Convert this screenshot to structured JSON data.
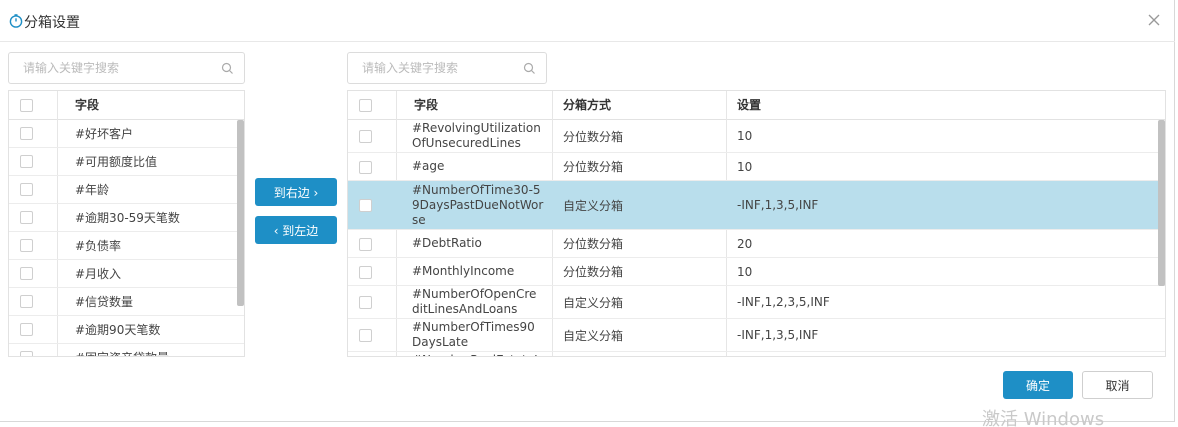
{
  "dialog": {
    "title": "分箱设置",
    "close_symbol": "✕"
  },
  "left": {
    "search_placeholder": "请输入关键字搜索",
    "header_field": "字段",
    "items": [
      {
        "label": "#好坏客户"
      },
      {
        "label": "#可用额度比值"
      },
      {
        "label": "#年龄"
      },
      {
        "label": "#逾期30-59天笔数"
      },
      {
        "label": "#负债率"
      },
      {
        "label": "#月收入"
      },
      {
        "label": "#信贷数量"
      },
      {
        "label": "#逾期90天笔数"
      },
      {
        "label": "#固定资产贷款量"
      }
    ]
  },
  "transfer": {
    "right_label": "到右边 ›",
    "left_label": "‹ 到左边"
  },
  "right": {
    "search_placeholder": "请输入关键字搜索",
    "header_field": "字段",
    "header_method": "分箱方式",
    "header_setting": "设置",
    "rows": [
      {
        "field": "#RevolvingUtilizationOfUnsecuredLines",
        "method": "分位数分箱",
        "setting": "10"
      },
      {
        "field": "#age",
        "method": "分位数分箱",
        "setting": "10"
      },
      {
        "field": "#NumberOfTime30-59DaysPastDueNotWorse",
        "method": "自定义分箱",
        "setting": "-INF,1,3,5,INF"
      },
      {
        "field": "#DebtRatio",
        "method": "分位数分箱",
        "setting": "20"
      },
      {
        "field": "#MonthlyIncome",
        "method": "分位数分箱",
        "setting": "10"
      },
      {
        "field": "#NumberOfOpenCreditLinesAndLoans",
        "method": "自定义分箱",
        "setting": "-INF,1,2,3,5,INF"
      },
      {
        "field": "#NumberOfTimes90DaysLate",
        "method": "自定义分箱",
        "setting": "-INF,1,3,5,INF"
      },
      {
        "field": "#NumberRealEstateLoansOrLines",
        "method": "",
        "setting": ""
      }
    ]
  },
  "footer": {
    "ok_label": "确定",
    "cancel_label": "取消"
  },
  "watermark": "激活 Windows",
  "colors": {
    "primary": "#1e8fc6",
    "selected_row": "#b9deec"
  },
  "icons": {
    "title": "timer-icon",
    "close": "close-icon",
    "search": "search-icon"
  }
}
